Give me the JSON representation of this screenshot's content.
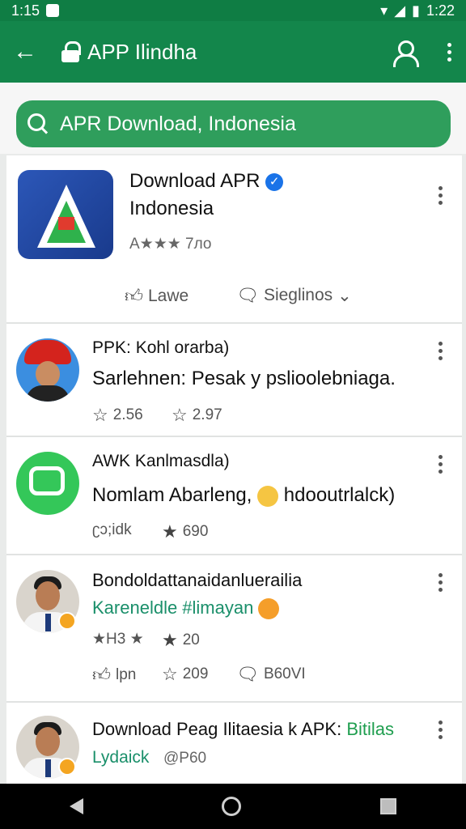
{
  "status_bar": {
    "time": "1:15",
    "right_time": "1:22"
  },
  "app_bar": {
    "title": "APP Ilindha"
  },
  "search": {
    "value": "APR Download, Indonesia"
  },
  "featured": {
    "title_line1": "Download APR",
    "title_line2": "Indonesia",
    "rating": "A★★★ 7ло",
    "like_label": "Lawe",
    "share_label": "Sieglinos"
  },
  "posts": [
    {
      "author": "PPK: Kohl orarba)",
      "text": "Sarlehnen: Pesak y pslioolebniaga.",
      "stat1": "2.56",
      "stat2": "2.97"
    },
    {
      "author": "AWK Kanlmasdla)",
      "text": "Nomlam Abarleng,",
      "text_after": "hdooutrlalck)",
      "stat1": "ʗɔ;idk",
      "stat2": "690"
    },
    {
      "author": "Bondoldattanaidanluerailia",
      "text": "Kareneldle #limayan",
      "stat_a": "★H3 ★",
      "stat_b": "20",
      "stat1": "lpn",
      "stat2": "209",
      "stat3": "B60VI"
    },
    {
      "author": "Download Peag Ilitaesia k APK:",
      "author_green": "Bitilas",
      "text": "Lydaick",
      "handle": "@P60"
    }
  ],
  "colors": {
    "toolbar": "#13864b",
    "search": "#2f9e5c",
    "accent": "#1f9e4f"
  }
}
